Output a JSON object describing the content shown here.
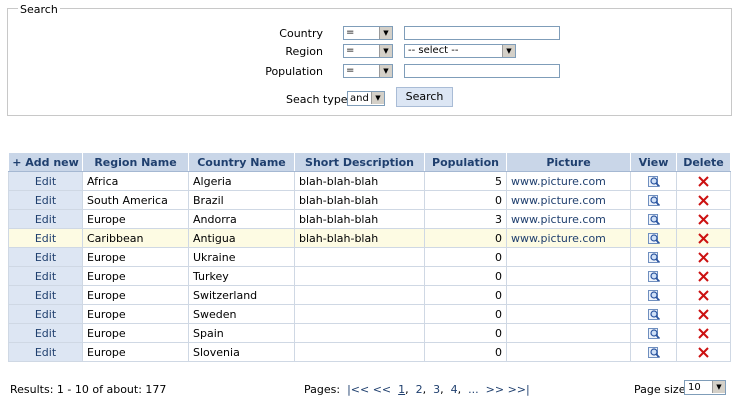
{
  "search": {
    "legend": "Search",
    "fields": [
      {
        "label": "Country",
        "operator": "=",
        "value": ""
      },
      {
        "label": "Region",
        "operator": "=",
        "value": "-- select --"
      },
      {
        "label": "Population",
        "operator": "=",
        "value": ""
      }
    ],
    "search_type_label": "Seach type:",
    "search_type_value": "and",
    "button_label": "Search"
  },
  "grid": {
    "add_new_label": "+ Add new",
    "columns": [
      "Region Name",
      "Country Name",
      "Short Description",
      "Population",
      "Picture",
      "View",
      "Delete"
    ],
    "edit_label": "Edit",
    "rows": [
      {
        "region": "Africa",
        "country": "Algeria",
        "description": "blah-blah-blah",
        "population": "5",
        "picture": "www.picture.com"
      },
      {
        "region": "South America",
        "country": "Brazil",
        "description": "blah-blah-blah",
        "population": "0",
        "picture": "www.picture.com"
      },
      {
        "region": "Europe",
        "country": "Andorra",
        "description": "blah-blah-blah",
        "population": "3",
        "picture": "www.picture.com"
      },
      {
        "region": "Caribbean",
        "country": "Antigua",
        "description": "blah-blah-blah",
        "population": "0",
        "picture": "www.picture.com",
        "highlighted": true
      },
      {
        "region": "Europe",
        "country": "Ukraine",
        "description": "",
        "population": "0",
        "picture": ""
      },
      {
        "region": "Europe",
        "country": "Turkey",
        "description": "",
        "population": "0",
        "picture": ""
      },
      {
        "region": "Europe",
        "country": "Switzerland",
        "description": "",
        "population": "0",
        "picture": ""
      },
      {
        "region": "Europe",
        "country": "Sweden",
        "description": "",
        "population": "0",
        "picture": ""
      },
      {
        "region": "Europe",
        "country": "Spain",
        "description": "",
        "population": "0",
        "picture": ""
      },
      {
        "region": "Europe",
        "country": "Slovenia",
        "description": "",
        "population": "0",
        "picture": ""
      }
    ],
    "icons": {
      "view": "magnifier-icon",
      "delete": "red-x-icon"
    }
  },
  "footer": {
    "results_text": "Results: 1 - 10 of about: 177",
    "pages_label": "Pages:",
    "nav_first": "|<<",
    "nav_prev": "<<",
    "pages": [
      "1",
      "2",
      "3",
      "4",
      "..."
    ],
    "current_page": "1",
    "nav_next": ">>",
    "nav_last": ">>|",
    "page_size_label": "Page size:",
    "page_size_value": "10"
  },
  "colors": {
    "header_bg": "#c9d6e8",
    "header_text": "#1f3f6e",
    "highlight_row": "#fdfbe3",
    "delete_red": "#cc1111"
  }
}
